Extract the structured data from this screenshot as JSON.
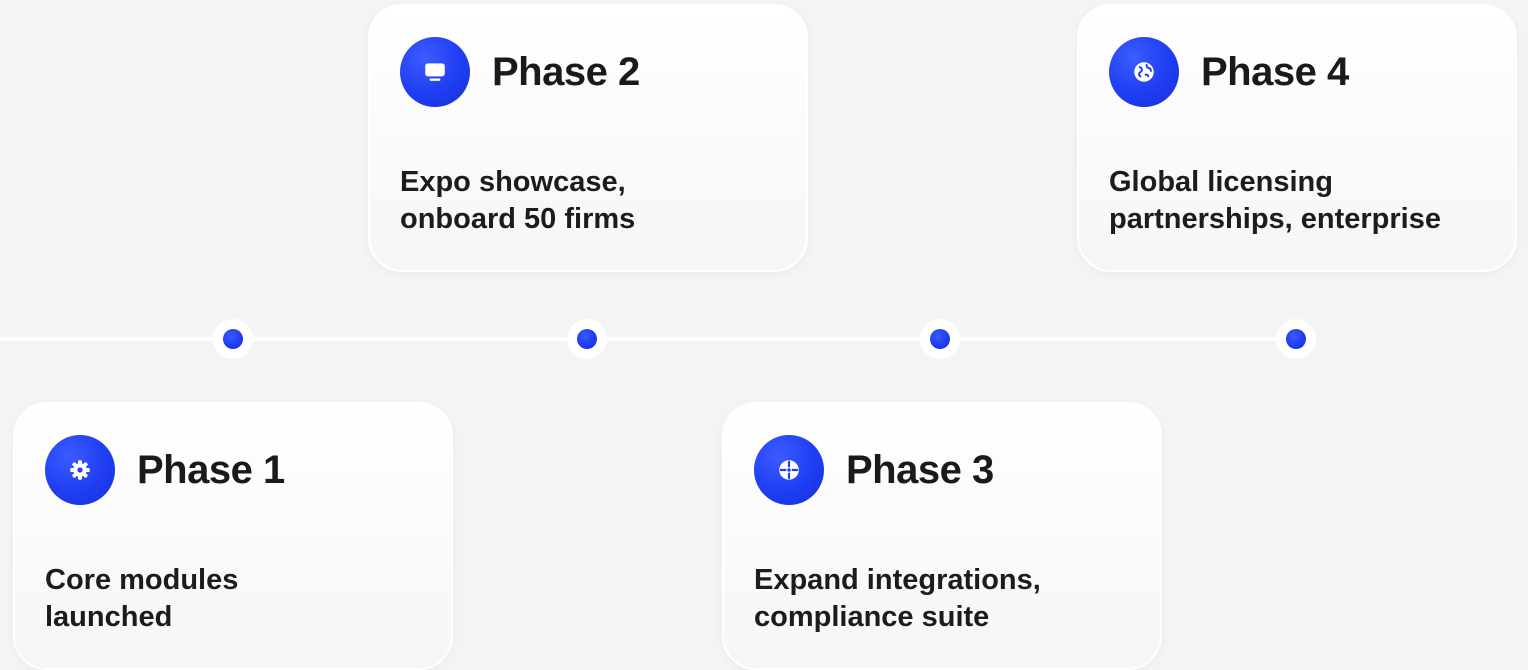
{
  "phases": [
    {
      "title": "Phase 1",
      "description": "Core modules\nlaunched",
      "icon": "gear-icon"
    },
    {
      "title": "Phase 2",
      "description": "Expo showcase,\nonboard 50 firms",
      "icon": "monitor-icon"
    },
    {
      "title": "Phase 3",
      "description": "Expand integrations,\ncompliance suite",
      "icon": "puzzle-icon"
    },
    {
      "title": "Phase 4",
      "description": "Global licensing\npartnerships, enterprise",
      "icon": "globe-icon"
    }
  ],
  "colors": {
    "background": "#f4f4f4",
    "accent": "#1f3df2",
    "card": "#ffffff",
    "text": "#1a1a1a"
  }
}
